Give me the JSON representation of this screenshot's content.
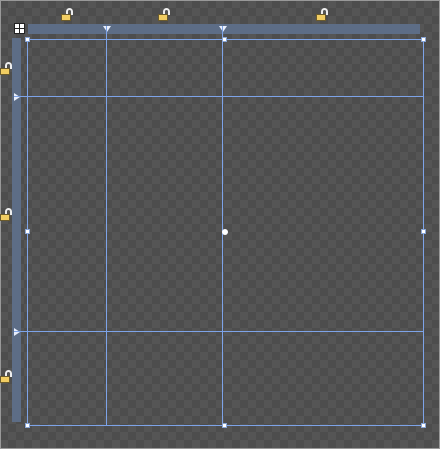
{
  "designer": {
    "kind": "grid-layout-designer",
    "columns": 3,
    "rows": 3,
    "colors": {
      "grid_line": "#7da3e8",
      "ruler": "#5d6d86",
      "lock_body": "#f1cd62"
    },
    "icons": {
      "grid_select": "grid-select-icon",
      "lock_open": "unlock-icon",
      "column_marker": "triangle-down-icon",
      "row_marker": "triangle-right-icon"
    }
  }
}
